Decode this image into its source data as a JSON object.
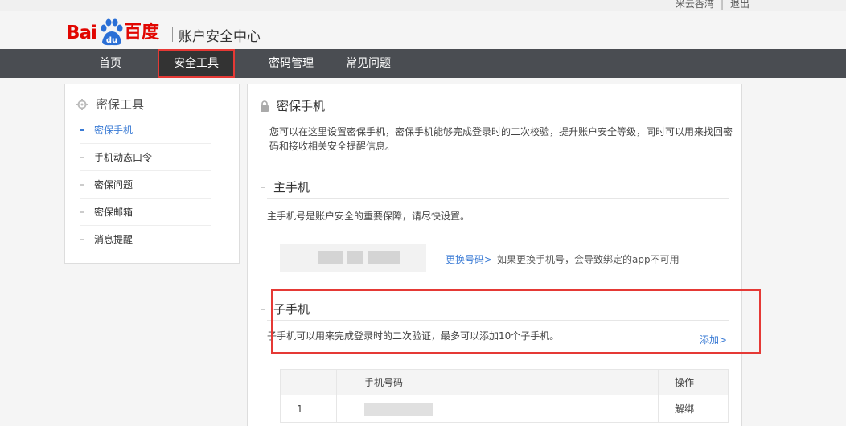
{
  "topbar": {
    "user": "米云香湾",
    "logout": "退出"
  },
  "header": {
    "logo_text": "Bai",
    "logo_cn": "百度",
    "site_title": "账户安全中心"
  },
  "nav": [
    {
      "label": "首页"
    },
    {
      "label": "安全工具",
      "active": true
    },
    {
      "label": "密码管理"
    },
    {
      "label": "常见问题"
    }
  ],
  "sidebar": {
    "title": "密保工具",
    "items": [
      {
        "label": "密保手机",
        "active": true
      },
      {
        "label": "手机动态口令"
      },
      {
        "label": "密保问题"
      },
      {
        "label": "密保邮箱"
      },
      {
        "label": "消息提醒"
      }
    ]
  },
  "main": {
    "title": "密保手机",
    "intro": "您可以在这里设置密保手机，密保手机能够完成登录时的二次校验，提升账户安全等级，同时可以用来找回密码和接收相关安全提醒信息。",
    "primary": {
      "heading": "主手机",
      "desc": "主手机号是账户安全的重要保障，请尽快设置。",
      "change_link": "更换号码>",
      "change_note": "如果更换手机号，会导致绑定的app不可用"
    },
    "sub": {
      "heading": "子手机",
      "desc": "子手机可以用来完成登录时的二次验证，最多可以添加10个子手机。",
      "add_link": "添加>"
    },
    "table": {
      "headers": [
        "",
        "手机号码",
        "操作"
      ],
      "rows": [
        {
          "index": "1",
          "action": "解绑"
        }
      ]
    }
  },
  "colors": {
    "brand_red": "#e10601",
    "link_blue": "#3a7bd5",
    "nav_bg": "#4a4d52",
    "highlight": "#e53935"
  }
}
